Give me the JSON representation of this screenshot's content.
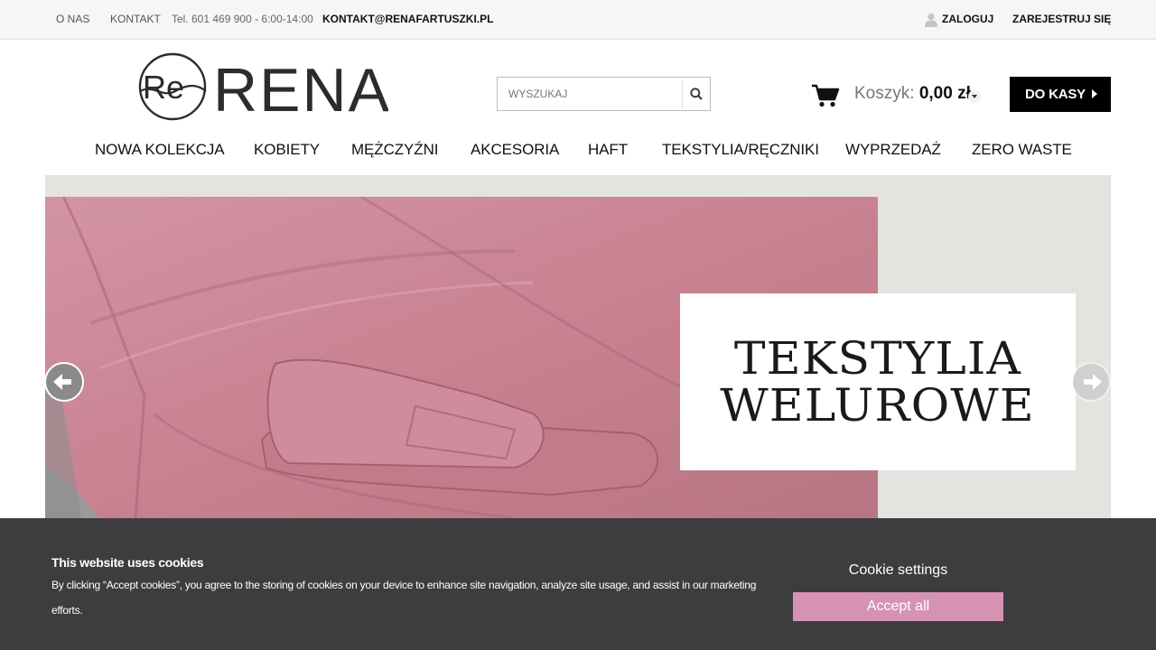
{
  "topbar": {
    "about": "O NAS",
    "contact": "KONTAKT",
    "phone": "Tel. 601 469 900 - 6:00-14:00",
    "email": "KONTAKT@RENAFARTUSZKI.PL",
    "login": "ZALOGUJ",
    "register": "ZAREJESTRUJ SIĘ"
  },
  "header": {
    "logo_text": "ReRENA",
    "search_placeholder": "WYSZUKAJ",
    "cart_label": "Koszyk:",
    "cart_amount": "0,00 zł",
    "checkout_label": "DO KASY"
  },
  "nav": {
    "items": [
      "NOWA KOLEKCJA",
      "KOBIETY",
      "MĘŻCZYŹNI",
      "AKCESORIA",
      "HAFT",
      "TEKSTYLIA/RĘCZNIKI",
      "WYPRZEDAŻ",
      "ZERO WASTE"
    ]
  },
  "hero": {
    "line1": "TEKSTYLIA",
    "line2": "WELUROWE"
  },
  "cookie": {
    "title": "This website uses cookies",
    "description": "By clicking “Accept cookies”, you agree to the storing of cookies on your device to enhance site navigation, analyze site usage, and assist in our marketing efforts.",
    "settings_label": "Cookie settings",
    "accept_label": "Accept all"
  },
  "colors": {
    "accent_pink": "#d592b3",
    "banner_bg": "#3d3d3f",
    "fabric_pink": "#c98597"
  },
  "icons": [
    "user-icon",
    "search-icon",
    "cart-icon",
    "caret-down-icon",
    "arrow-left-icon",
    "arrow-right-icon"
  ]
}
